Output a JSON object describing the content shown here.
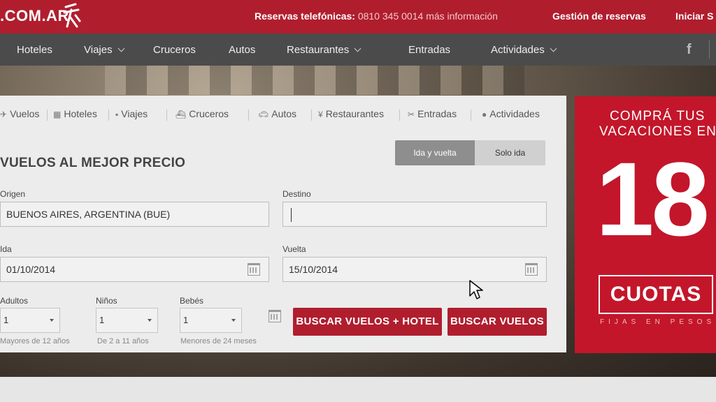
{
  "header": {
    "brand": ".COM.AR",
    "phone_label": "Reservas telefónicas:",
    "phone_number": "0810 345 0014",
    "phone_more": "más información",
    "manage_bookings": "Gestión de reservas",
    "login": "Iniciar S"
  },
  "nav": {
    "items": [
      {
        "label": "Hoteles",
        "dropdown": false
      },
      {
        "label": "Viajes",
        "dropdown": true
      },
      {
        "label": "Cruceros",
        "dropdown": false
      },
      {
        "label": "Autos",
        "dropdown": false
      },
      {
        "label": "Restaurantes",
        "dropdown": true
      },
      {
        "label": "Entradas",
        "dropdown": false
      },
      {
        "label": "Actividades",
        "dropdown": true
      }
    ],
    "social_icon": "facebook-icon"
  },
  "search": {
    "tabs": [
      {
        "label": "Vuelos",
        "icon": "plane-icon"
      },
      {
        "label": "Hoteles",
        "icon": "hotel-icon"
      },
      {
        "label": "Viajes",
        "icon": "suitcase-icon"
      },
      {
        "label": "Cruceros",
        "icon": "ship-icon"
      },
      {
        "label": "Autos",
        "icon": "car-icon"
      },
      {
        "label": "Restaurantes",
        "icon": "fork-knife-icon"
      },
      {
        "label": "Entradas",
        "icon": "ticket-icon"
      },
      {
        "label": "Actividades",
        "icon": "pin-icon"
      }
    ],
    "title": "VUELOS AL MEJOR PRECIO",
    "trip_type": {
      "round_trip": "Ida y vuelta",
      "one_way": "Solo ida",
      "selected": "Ida y vuelta"
    },
    "origin": {
      "label": "Origen",
      "value": "BUENOS AIRES, ARGENTINA (BUE)"
    },
    "destination": {
      "label": "Destino",
      "value": ""
    },
    "depart": {
      "label": "Ida",
      "value": "01/10/2014"
    },
    "return": {
      "label": "Vuelta",
      "value": "15/10/2014"
    },
    "adults": {
      "label": "Adultos",
      "value": "1",
      "hint": "Mayores de 12 años"
    },
    "children": {
      "label": "Niños",
      "value": "1",
      "hint": "De 2 a 11 años"
    },
    "infants": {
      "label": "Bebés",
      "value": "1",
      "hint": "Menores de 24 meses"
    },
    "btn_flights_hotel": "BUSCAR VUELOS + HOTEL",
    "btn_flights": "BUSCAR VUELOS"
  },
  "promo": {
    "line1": "COMPRÁ TUS",
    "line2": "VACACIONES EN",
    "number": "18",
    "box": "CUOTAS",
    "line3": "FIJAS EN PESOS"
  },
  "colors": {
    "brand_red": "#b01e2e",
    "nav_gray": "#4b4b4b"
  }
}
